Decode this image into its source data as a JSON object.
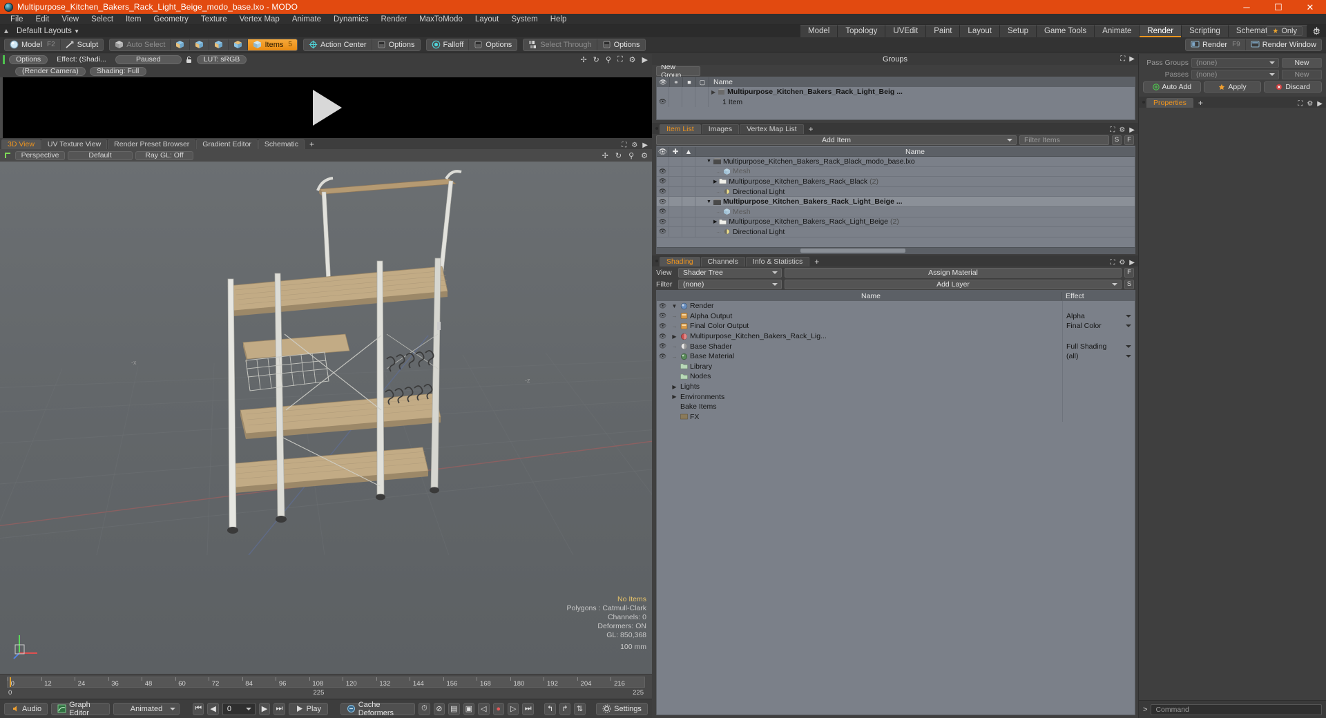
{
  "titlebar": {
    "title": "Multipurpose_Kitchen_Bakers_Rack_Light_Beige_modo_base.lxo - MODO",
    "minimize": "─",
    "maximize": "☐",
    "close": "✕"
  },
  "menu": {
    "items": [
      "File",
      "Edit",
      "View",
      "Select",
      "Item",
      "Geometry",
      "Texture",
      "Vertex Map",
      "Animate",
      "Dynamics",
      "Render",
      "MaxToModo",
      "Layout",
      "System",
      "Help"
    ]
  },
  "layoutrow": {
    "default_layouts": "Default Layouts",
    "tabs": [
      {
        "label": "Model",
        "active": false
      },
      {
        "label": "Topology",
        "active": false
      },
      {
        "label": "UVEdit",
        "active": false
      },
      {
        "label": "Paint",
        "active": false
      },
      {
        "label": "Layout",
        "active": false
      },
      {
        "label": "Setup",
        "active": false
      },
      {
        "label": "Game Tools",
        "active": false
      },
      {
        "label": "Animate",
        "active": false
      },
      {
        "label": "Render",
        "active": true
      },
      {
        "label": "Scripting",
        "active": false
      },
      {
        "label": "Schematic Fusion",
        "active": false
      }
    ],
    "plus": "+",
    "only_badge": "Only",
    "star": "★"
  },
  "toolbar": {
    "model": "Model",
    "model_hotkey": "F2",
    "sculpt": "Sculpt",
    "auto_select": "Auto Select",
    "items": "Items",
    "items_hotkey": "5",
    "action_center": "Action Center",
    "options1": "Options",
    "falloff": "Falloff",
    "options2": "Options",
    "select_through": "Select Through",
    "options3": "Options",
    "render": "Render",
    "render_hotkey": "F9",
    "render_window": "Render Window"
  },
  "render_preview": {
    "options": "Options",
    "effect": "Effect: (Shadi...",
    "paused": "Paused",
    "lut": "LUT: sRGB",
    "camera": "(Render Camera)",
    "shading": "Shading: Full",
    "icons": [
      "move-icon",
      "rotate-icon",
      "zoom-icon",
      "fit-icon",
      "gear-icon",
      "play-icon"
    ]
  },
  "viewport_tabs": {
    "tabs": [
      {
        "label": "3D View",
        "active": true
      },
      {
        "label": "UV Texture View",
        "active": false
      },
      {
        "label": "Render Preset Browser",
        "active": false
      },
      {
        "label": "Gradient Editor",
        "active": false
      },
      {
        "label": "Schematic",
        "active": false
      }
    ],
    "plus": "+"
  },
  "viewport_header": {
    "perspective": "Perspective",
    "default": "Default",
    "raygl": "Ray GL: Off"
  },
  "viewport_stats": {
    "no_items": "No Items",
    "polygons": "Polygons : Catmull-Clark",
    "channels": "Channels: 0",
    "deformers": "Deformers: ON",
    "gl": "GL: 850,368",
    "scale": "100 mm"
  },
  "timeline": {
    "ticks": [
      "0",
      "12",
      "24",
      "36",
      "48",
      "60",
      "72",
      "84",
      "96",
      "108",
      "120",
      "132",
      "144",
      "156",
      "168",
      "180",
      "192",
      "204",
      "216"
    ],
    "start": "0",
    "end_center": "225",
    "end_right": "225"
  },
  "bottombar": {
    "audio": "Audio",
    "graph_editor": "Graph Editor",
    "animated": "Animated",
    "frame_value": "0",
    "play": "Play",
    "cache_deformers": "Cache Deformers",
    "settings": "Settings"
  },
  "groups_panel": {
    "title": "Groups",
    "new_group": "New Group",
    "columns": [
      "eye-icon",
      "link-icon",
      "box-icon",
      "lock-icon",
      "Name"
    ],
    "rows": [
      {
        "name": "Multipurpose_Kitchen_Bakers_Rack_Light_Beig ...",
        "sub": "1 Item",
        "bold": true
      }
    ]
  },
  "item_list": {
    "tabs": [
      {
        "label": "Item List",
        "active": true
      },
      {
        "label": "Images",
        "active": false
      },
      {
        "label": "Vertex Map List",
        "active": false
      }
    ],
    "plus": "+",
    "add_item": "Add Item",
    "filter_placeholder": "Filter Items",
    "btn_s": "S",
    "btn_f": "F",
    "col_name": "Name",
    "rows": [
      {
        "name": "Multipurpose_Kitchen_Bakers_Rack_Black_modo_base.lxo",
        "icon": "scene-icon",
        "indent": 0,
        "expanded": true,
        "bold": false,
        "eye": false
      },
      {
        "name": "Mesh",
        "icon": "mesh-icon",
        "indent": 1,
        "dim": true,
        "eye": true
      },
      {
        "name": "Multipurpose_Kitchen_Bakers_Rack_Black",
        "icon": "folder-icon",
        "indent": 1,
        "count": "(2)",
        "collapsed": true,
        "eye": true
      },
      {
        "name": "Directional Light",
        "icon": "light-icon",
        "indent": 1,
        "eye": true
      },
      {
        "name": "Multipurpose_Kitchen_Bakers_Rack_Light_Beige ...",
        "icon": "scene-icon",
        "indent": 0,
        "expanded": true,
        "bold": true,
        "eye": true
      },
      {
        "name": "Mesh",
        "icon": "mesh-icon",
        "indent": 1,
        "dim": true,
        "eye": true
      },
      {
        "name": "Multipurpose_Kitchen_Bakers_Rack_Light_Beige",
        "icon": "folder-icon",
        "indent": 1,
        "count": "(2)",
        "collapsed": true,
        "eye": true
      },
      {
        "name": "Directional Light",
        "icon": "light-icon",
        "indent": 1,
        "eye": true
      }
    ]
  },
  "shading_panel": {
    "tabs": [
      {
        "label": "Shading",
        "active": true
      },
      {
        "label": "Channels",
        "active": false
      },
      {
        "label": "Info & Statistics",
        "active": false
      }
    ],
    "plus": "+",
    "view_label": "View",
    "view_value": "Shader Tree",
    "assign_material": "Assign Material",
    "btn_f": "F",
    "filter_label": "Filter",
    "filter_value": "(none)",
    "add_layer": "Add Layer",
    "btn_s": "S",
    "col_name": "Name",
    "col_effect": "Effect",
    "rows": [
      {
        "name": "Render",
        "effect": "",
        "indent": 0,
        "icon": "render-icon",
        "eye": true,
        "expanded": true
      },
      {
        "name": "Alpha Output",
        "effect": "Alpha",
        "indent": 1,
        "icon": "output-icon",
        "eye": true,
        "drop": true
      },
      {
        "name": "Final Color Output",
        "effect": "Final Color",
        "indent": 1,
        "icon": "output-icon",
        "eye": true,
        "drop": true
      },
      {
        "name": "Multipurpose_Kitchen_Bakers_Rack_Lig...",
        "effect": "",
        "indent": 1,
        "icon": "material-group-icon",
        "eye": true,
        "collapsed": true
      },
      {
        "name": "Base Shader",
        "effect": "Full Shading",
        "indent": 1,
        "icon": "shader-icon",
        "eye": true,
        "drop": true
      },
      {
        "name": "Base Material",
        "effect": "(all)",
        "indent": 1,
        "icon": "material-icon",
        "eye": true,
        "drop": true
      },
      {
        "name": "Library",
        "effect": "",
        "indent": 1,
        "icon": "library-icon",
        "eye": false
      },
      {
        "name": "Nodes",
        "effect": "",
        "indent": 1,
        "icon": "nodes-icon",
        "eye": false
      },
      {
        "name": "Lights",
        "effect": "",
        "indent": 0,
        "icon": "",
        "eye": false,
        "collapsed": true
      },
      {
        "name": "Environments",
        "effect": "",
        "indent": 0,
        "icon": "",
        "eye": false,
        "collapsed": true
      },
      {
        "name": "Bake Items",
        "effect": "",
        "indent": 0,
        "icon": "",
        "eye": false
      },
      {
        "name": "FX",
        "effect": "",
        "indent": 0,
        "icon": "fx-icon",
        "eye": false
      }
    ]
  },
  "properties_panel": {
    "pass_groups_label": "Pass Groups",
    "pass_groups_value": "(none)",
    "passes_label": "Passes",
    "passes_value": "(none)",
    "new_label": "New",
    "new_label2": "New",
    "auto_add": "Auto Add",
    "apply": "Apply",
    "discard": "Discard",
    "properties_tab": "Properties",
    "plus": "+"
  },
  "command_bar": {
    "prompt": ">",
    "placeholder": "Command"
  },
  "colors": {
    "accent_orange": "#f0951e",
    "title_orange": "#e24a10",
    "panel_bg": "#3f3f3f",
    "list_bg": "#7b8089",
    "viewport_bg": "#63676a"
  }
}
